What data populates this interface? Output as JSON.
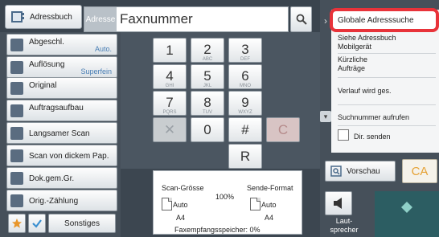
{
  "header": {
    "address_book_label": "Adressbuch",
    "destination_type": "Adresse",
    "destination_value": "Faxnummer"
  },
  "settings": [
    {
      "label": "Abgeschl.",
      "value": "Auto."
    },
    {
      "label": "Auflösung",
      "value": "Superfein"
    },
    {
      "label": "Original",
      "value": ""
    },
    {
      "label": "Auftragsaufbau",
      "value": ""
    },
    {
      "label": "Langsamer Scan",
      "value": ""
    },
    {
      "label": "Scan von dickem Pap.",
      "value": ""
    },
    {
      "label": "Dok.gem.Gr.",
      "value": ""
    },
    {
      "label": "Orig.-Zählung",
      "value": ""
    }
  ],
  "bottom_left": {
    "other_label": "Sonstiges"
  },
  "keypad": {
    "keys": [
      {
        "digit": "1",
        "letters": ""
      },
      {
        "digit": "2",
        "letters": "ABC"
      },
      {
        "digit": "3",
        "letters": "DEF"
      },
      {
        "digit": "4",
        "letters": "GHI"
      },
      {
        "digit": "5",
        "letters": "JKL"
      },
      {
        "digit": "6",
        "letters": "MNO"
      },
      {
        "digit": "7",
        "letters": "PQRS"
      },
      {
        "digit": "8",
        "letters": "TUV"
      },
      {
        "digit": "9",
        "letters": "WXYZ"
      }
    ],
    "clear_entry": "✕",
    "zero": "0",
    "hash": "#",
    "clear": "C",
    "redial": "R"
  },
  "info": {
    "scan_size_label": "Scan-Grösse",
    "scan_size_value": "Auto",
    "scan_size_paper": "A4",
    "ratio": "100%",
    "send_format_label": "Sende-Format",
    "send_format_value": "Auto",
    "send_format_paper": "A4",
    "memory_label": "Faxempfangsspeicher: 0%"
  },
  "menu": {
    "highlighted": "Globale Adresssuche",
    "items": [
      "Siehe Adressbuch",
      "Mobilgerät",
      "Kürzliche Aufträge",
      "Verlauf wird ges.",
      "Suchnummer aufrufen",
      "Dir. senden"
    ]
  },
  "actions": {
    "preview_label": "Vorschau",
    "ca_label": "CA",
    "speaker_label": "Laut- sprecher"
  },
  "colors": {
    "accent_red": "#e8333a",
    "start_teal": "#2c5d62",
    "value_blue": "#4a7fb5"
  }
}
